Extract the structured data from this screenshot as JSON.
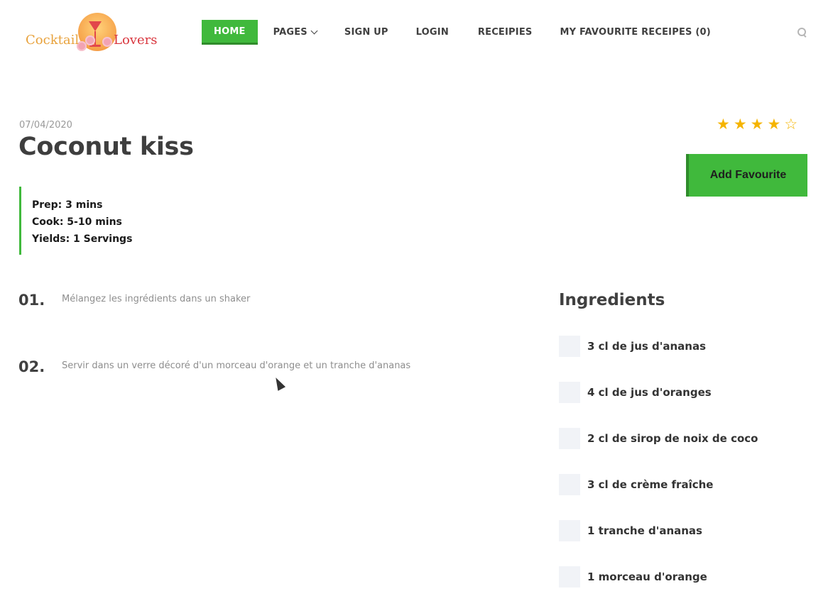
{
  "logo": {
    "word1": "Cocktail",
    "word2": "Lovers"
  },
  "nav": {
    "items": [
      {
        "label": "HOME",
        "active": true
      },
      {
        "label": "PAGES",
        "dropdown": true
      },
      {
        "label": "SIGN UP"
      },
      {
        "label": "LOGIN"
      },
      {
        "label": "RECEIPIES"
      },
      {
        "label": "MY FAVOURITE RECEIPES (0)"
      }
    ]
  },
  "recipe": {
    "date": "07/04/2020",
    "title": "Coconut kiss",
    "rating": {
      "value": 4,
      "max": 5
    },
    "favourite_label": "Add Favourite",
    "meta": {
      "prep": "Prep: 3 mins",
      "cook": "Cook: 5-10 mins",
      "yields": "Yields: 1 Servings"
    },
    "steps": [
      {
        "num": "01.",
        "text": "Mélangez les ingrédients dans un shaker"
      },
      {
        "num": "02.",
        "text": "Servir dans un verre décoré d'un morceau d'orange et un tranche d'ananas"
      }
    ],
    "ingredients_title": "Ingredients",
    "ingredients": [
      "3 cl de jus d'ananas",
      "4 cl de jus d'oranges",
      "2 cl de sirop de noix de coco",
      "3 cl de crème fraîche",
      "1 tranche d'ananas",
      "1 morceau d'orange"
    ]
  },
  "colors": {
    "accent": "#40b93c",
    "accent_dark": "#2f8c2b",
    "star": "#f5b400"
  }
}
